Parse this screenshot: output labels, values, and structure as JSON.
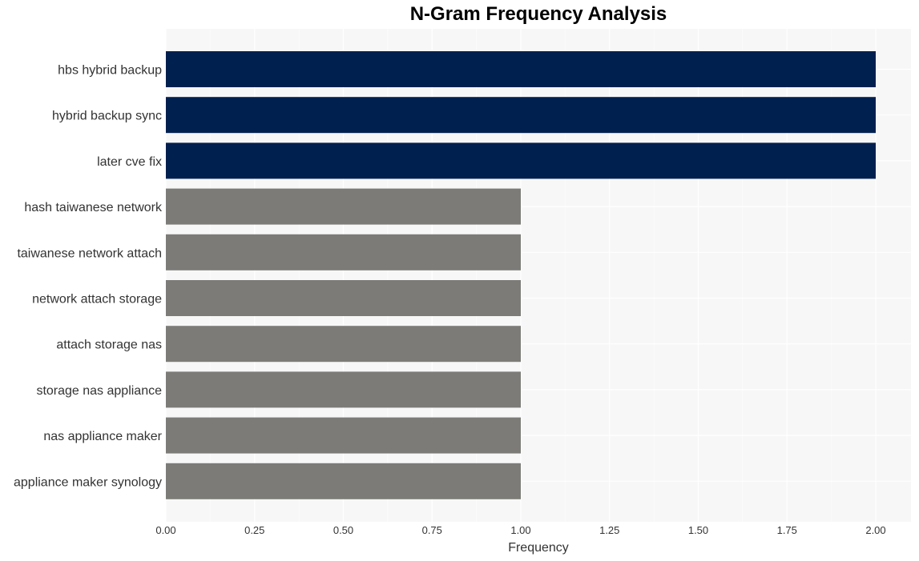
{
  "chart_data": {
    "type": "bar",
    "orientation": "horizontal",
    "title": "N-Gram Frequency Analysis",
    "xlabel": "Frequency",
    "ylabel": "",
    "xlim": [
      0,
      2.1
    ],
    "xticks": [
      "0.00",
      "0.25",
      "0.50",
      "0.75",
      "1.00",
      "1.25",
      "1.50",
      "1.75",
      "2.00"
    ],
    "xtick_values": [
      0,
      0.25,
      0.5,
      0.75,
      1.0,
      1.25,
      1.5,
      1.75,
      2.0
    ],
    "grid": true,
    "categories": [
      "hbs hybrid backup",
      "hybrid backup sync",
      "later cve fix",
      "hash taiwanese network",
      "taiwanese network attach",
      "network attach storage",
      "attach storage nas",
      "storage nas appliance",
      "nas appliance maker",
      "appliance maker synology"
    ],
    "values": [
      2,
      2,
      2,
      1,
      1,
      1,
      1,
      1,
      1,
      1
    ],
    "colors": {
      "high": "#00204f",
      "low": "#7c7b77",
      "panel": "#f7f7f7",
      "grid": "#ffffff"
    }
  }
}
